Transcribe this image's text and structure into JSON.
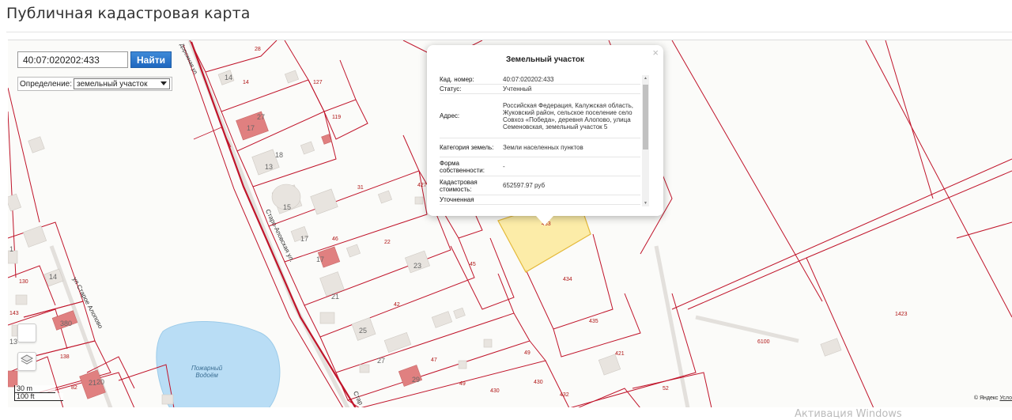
{
  "page": {
    "title": "Публичная кадастровая карта"
  },
  "search": {
    "value": "40:07:020202:433",
    "button_label": "Найти"
  },
  "definition": {
    "label": "Определение:",
    "selected": "земельный участок"
  },
  "scale": {
    "meters": "30 m",
    "feet": "100 ft"
  },
  "copyright": {
    "text": "© Яндекс",
    "link": "Усло"
  },
  "watermark": "Активация Windows",
  "water_body": {
    "line1": "Пожарный",
    "line2": "Водоём"
  },
  "streets": [
    "Старо-Аповская ул.",
    "ул Старое Алопово",
    "Дорожная ул.",
    "Стар"
  ],
  "parcel_labels": [
    "28",
    "14",
    "127",
    "119",
    "31",
    "427",
    "46",
    "22",
    "45",
    "23",
    "42",
    "30",
    "49",
    "430",
    "432",
    "52",
    "421",
    "435",
    "434",
    "433",
    "1423",
    "6100",
    "130",
    "143",
    "138",
    "82",
    "47",
    "49",
    "130"
  ],
  "house_numbers": [
    "14",
    "27",
    "17",
    "18",
    "13",
    "15",
    "17",
    "17",
    "23",
    "21",
    "25",
    "27",
    "29",
    "14",
    "380",
    "21",
    "25",
    "20",
    "1",
    "13"
  ],
  "popup": {
    "title": "Земельный участок",
    "close": "×",
    "rows": [
      {
        "key": "Кад. номер:",
        "value": "40:07:020202:433"
      },
      {
        "key": "Статус:",
        "value": "Учтенный"
      },
      {
        "key": "Адрес:",
        "value": "Российская Федерация, Калужская область, Жуковский район, сельское поселение село Совхоз «Победа», деревня Алопово, улица Семеновская, земельный участок 5"
      },
      {
        "key": "Категория земель:",
        "value": "Земли населенных пунктов"
      },
      {
        "key": "Форма собственности:",
        "value": "-"
      },
      {
        "key": "Кадастровая стоимость:",
        "value": "652597.97 руб"
      },
      {
        "key": "Уточненная",
        "value": ""
      }
    ]
  },
  "colors": {
    "parcel_line": "#c0142a",
    "selected_fill": "#fbe99a",
    "selected_stroke": "#e4b93a",
    "house": "#e8e4df",
    "house_red": "#e08080",
    "water": "#b9ddf5"
  }
}
